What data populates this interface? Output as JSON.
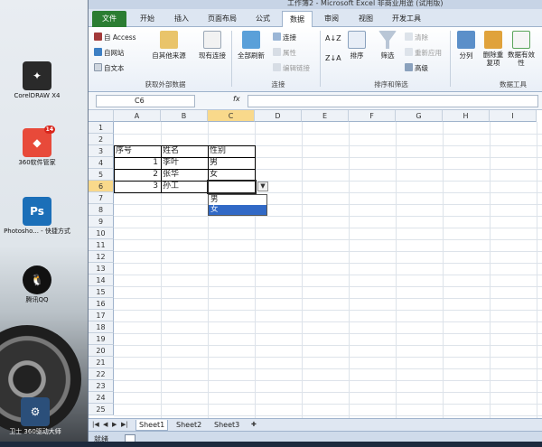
{
  "desktop": {
    "icons": [
      {
        "label": "CorelDRAW X4",
        "icon": "corel-icon",
        "color": "#2a2a2a"
      },
      {
        "label": "360软件管家",
        "icon": "software-manager-icon",
        "color": "#e84a3a",
        "badge": "14"
      },
      {
        "label": "Photosho... - 快捷方式",
        "icon": "photoshop-icon",
        "color": "#1b6fb8"
      },
      {
        "label": "腾讯QQ",
        "icon": "qq-icon",
        "color": "#111111"
      },
      {
        "label": "卫士 360驱动大师",
        "icon": "driver-master-icon",
        "color": "#2b4f7a"
      }
    ]
  },
  "excel": {
    "title": "工作簿2 - Microsoft Excel 非商业用途 (试用版)",
    "tabs": [
      "文件",
      "开始",
      "插入",
      "页面布局",
      "公式",
      "数据",
      "审阅",
      "视图",
      "开发工具"
    ],
    "active_tab": "数据",
    "ribbon": {
      "external": {
        "access": "自 Access",
        "web": "自网站",
        "text": "自文本",
        "other": "自其他来源",
        "existing": "现有连接",
        "group": "获取外部数据"
      },
      "connections": {
        "refresh": "全部刷新",
        "conn": "连接",
        "props": "属性",
        "edit_links": "编辑链接",
        "group": "连接"
      },
      "sort": {
        "sort": "排序",
        "filter": "筛选",
        "clear": "清除",
        "reapply": "重新应用",
        "advanced": "高级",
        "group": "排序和筛选"
      },
      "tools": {
        "split": "分列",
        "dedupe": "删除重复项",
        "validation": "数据有效性",
        "group": "数据工具"
      }
    },
    "namebox": "C6",
    "fx": "fx",
    "columns": [
      "A",
      "B",
      "C",
      "D",
      "E",
      "F",
      "G",
      "H",
      "I"
    ],
    "rows": [
      "1",
      "2",
      "3",
      "4",
      "5",
      "6",
      "7",
      "8",
      "9",
      "10",
      "11",
      "12",
      "13",
      "14",
      "15",
      "16",
      "17",
      "18",
      "19",
      "20",
      "21",
      "22",
      "23",
      "24",
      "25"
    ],
    "table": {
      "headers": [
        "序号",
        "姓名",
        "性别"
      ],
      "rows": [
        {
          "no": "1",
          "name": "李叶",
          "gender": "男"
        },
        {
          "no": "2",
          "name": "张华",
          "gender": "女"
        },
        {
          "no": "3",
          "name": "孙工",
          "gender": ""
        }
      ]
    },
    "dropdown": {
      "options": [
        "男",
        "女"
      ],
      "highlighted": "女"
    },
    "sheets": [
      "Sheet1",
      "Sheet2",
      "Sheet3"
    ],
    "active_sheet": "Sheet1",
    "status": "就绪"
  }
}
